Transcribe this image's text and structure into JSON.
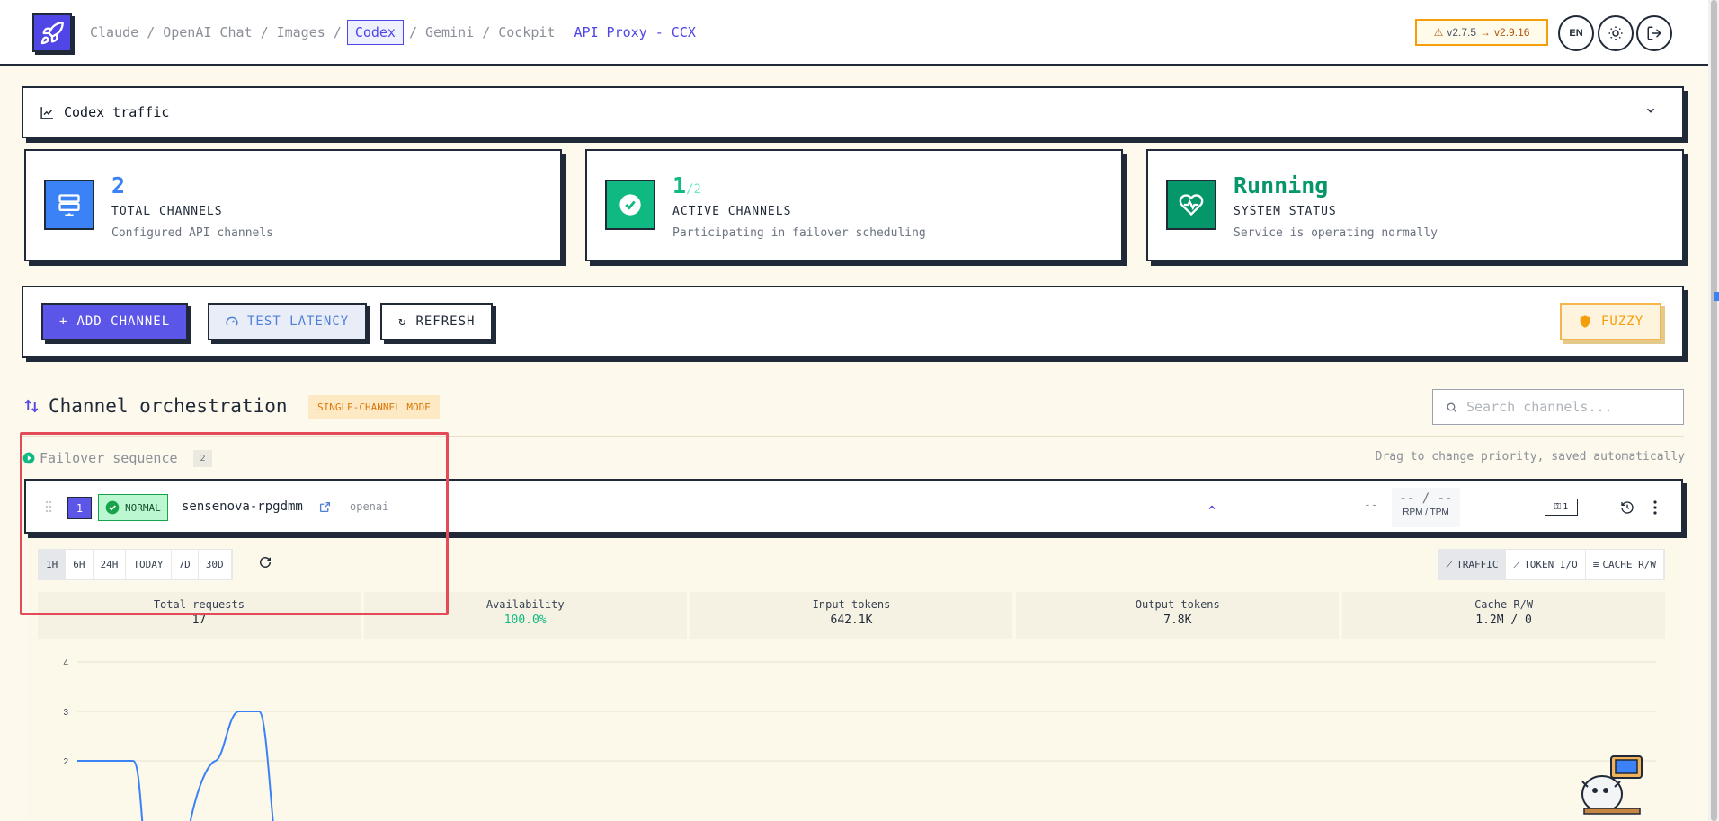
{
  "nav": {
    "items": [
      "Claude",
      "OpenAI Chat",
      "Images",
      "Codex",
      "Gemini",
      "Cockpit"
    ],
    "active": "Codex",
    "app_title": "API Proxy - CCX"
  },
  "header": {
    "version_current": "v2.7.5",
    "version_arrow": "→",
    "version_latest": "v2.9.16",
    "lang": "EN"
  },
  "traffic": {
    "label": "Codex traffic"
  },
  "stats": [
    {
      "value": "2",
      "suffix": "",
      "name": "TOTAL CHANNELS",
      "desc": "Configured API channels",
      "color": "#3b82f6"
    },
    {
      "value": "1",
      "suffix": "/2",
      "name": "ACTIVE CHANNELS",
      "desc": "Participating in failover scheduling",
      "color": "#10b981"
    },
    {
      "value": "Running",
      "suffix": "",
      "name": "SYSTEM STATUS",
      "desc": "Service is operating normally",
      "color": "#059669"
    }
  ],
  "actions": {
    "add": "ADD CHANNEL",
    "test": "TEST LATENCY",
    "refresh": "REFRESH",
    "fuzzy": "FUZZY"
  },
  "orchestration": {
    "title": "Channel orchestration",
    "mode": "SINGLE-CHANNEL MODE",
    "search_placeholder": "Search channels..."
  },
  "failover": {
    "label": "Failover sequence",
    "count": "2",
    "hint": "Drag to change priority, saved automatically"
  },
  "channel": {
    "priority": "1",
    "status": "NORMAL",
    "name": "sensenova-rpgdmm",
    "type": "openai",
    "empty": "--",
    "rpm_tpm": "-- / --",
    "rpm_label": "RPM / TPM",
    "keys": "1"
  },
  "ranges": [
    "1H",
    "6H",
    "24H",
    "TODAY",
    "7D",
    "30D"
  ],
  "active_range": "1H",
  "views": [
    "TRAFFIC",
    "TOKEN I/O",
    "CACHE R/W"
  ],
  "active_view": "TRAFFIC",
  "metrics": [
    {
      "name": "Total requests",
      "value": "17"
    },
    {
      "name": "Availability",
      "value": "100.0%"
    },
    {
      "name": "Input tokens",
      "value": "642.1K"
    },
    {
      "name": "Output tokens",
      "value": "7.8K"
    },
    {
      "name": "Cache R/W",
      "value": "1.2M / 0"
    }
  ],
  "chart_data": {
    "type": "line",
    "ytick_labels": [
      "4",
      "3",
      "2"
    ],
    "series": [
      {
        "values": [
          2,
          2,
          2,
          0.5,
          null,
          null,
          2,
          3,
          3,
          0.5
        ]
      }
    ],
    "color": "#3b82f6"
  }
}
